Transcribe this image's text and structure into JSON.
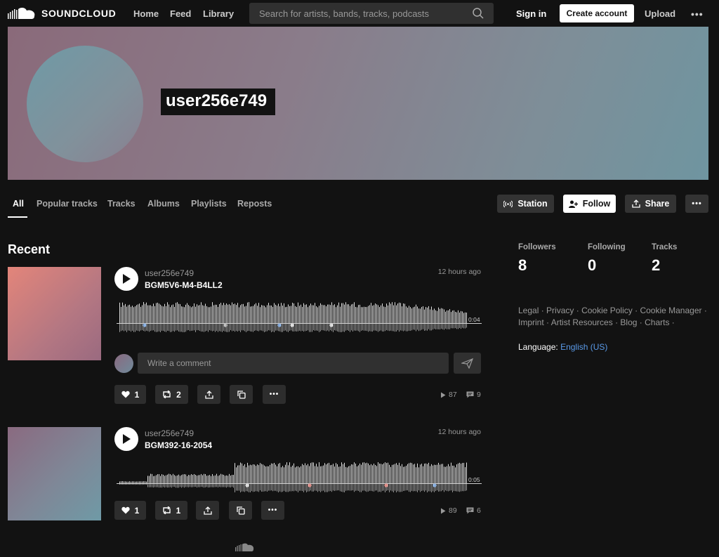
{
  "header": {
    "logo_text": "SOUNDCLOUD",
    "nav": [
      "Home",
      "Feed",
      "Library"
    ],
    "search_placeholder": "Search for artists, bands, tracks, podcasts",
    "signin_label": "Sign in",
    "create_account_label": "Create account",
    "upload_label": "Upload",
    "more_label": "•••"
  },
  "profile": {
    "username": "user256e749"
  },
  "tabs": [
    "All",
    "Popular tracks",
    "Tracks",
    "Albums",
    "Playlists",
    "Reposts"
  ],
  "actions": {
    "station_label": "Station",
    "follow_label": "Follow",
    "share_label": "Share",
    "more_label": "•••"
  },
  "recent": {
    "title": "Recent",
    "comment_placeholder": "Write a comment",
    "tracks": [
      {
        "user": "user256e749",
        "title": "BGM5V6-M4-B4LL2",
        "posted": "12 hours ago",
        "duration": "0:04",
        "likes": "1",
        "reposts": "2",
        "plays": "87",
        "comments": "9"
      },
      {
        "user": "user256e749",
        "title": "BGM392-16-2054",
        "posted": "12 hours ago",
        "duration": "0:05",
        "likes": "1",
        "reposts": "1",
        "plays": "89",
        "comments": "6"
      }
    ]
  },
  "stats": [
    {
      "label": "Followers",
      "value": "8"
    },
    {
      "label": "Following",
      "value": "0"
    },
    {
      "label": "Tracks",
      "value": "2"
    }
  ],
  "footer": {
    "links": [
      "Legal",
      "Privacy",
      "Cookie Policy",
      "Cookie Manager",
      "Imprint",
      "Artist Resources",
      "Blog",
      "Charts"
    ],
    "language_label": "Language:",
    "language_value": "English (US)"
  },
  "colors": {
    "background": "#121212",
    "accent_link": "#5a9ae8",
    "button_dark": "#333333"
  }
}
